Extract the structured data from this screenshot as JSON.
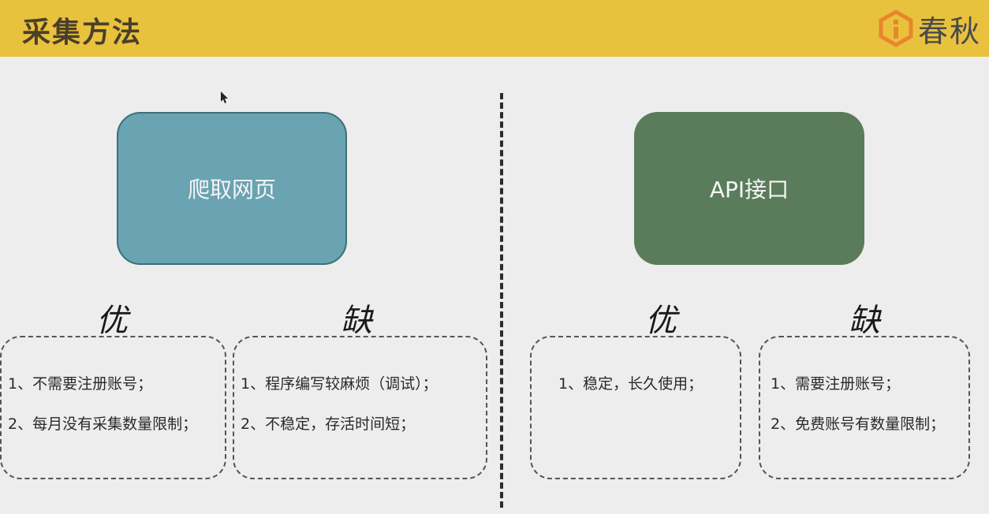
{
  "header": {
    "title": "采集方法",
    "logo_text": "春秋",
    "logo_icon": "chunqiu-logo-icon",
    "background": "#e8c23d"
  },
  "left": {
    "method_label": "爬取网页",
    "method_color": "#6aa3b2",
    "pros_heading": "优",
    "cons_heading": "缺",
    "pros": [
      "1、不需要注册账号；",
      "2、每月没有采集数量限制；"
    ],
    "cons": [
      "1、程序编写较麻烦（调试）；",
      "2、不稳定，存活时间短；"
    ]
  },
  "right": {
    "method_label": "API接口",
    "method_color": "#5a7c5b",
    "pros_heading": "优",
    "cons_heading": "缺",
    "pros": [
      "1、稳定，长久使用；"
    ],
    "cons": [
      "1、需要注册账号；",
      "2、免费账号有数量限制；"
    ]
  }
}
